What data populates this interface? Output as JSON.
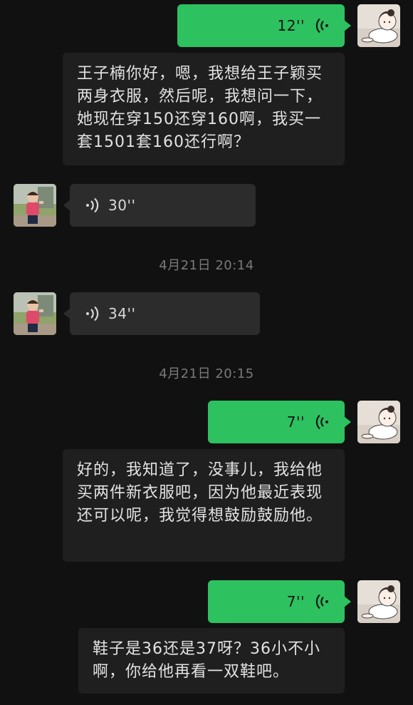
{
  "messages": [
    {
      "sender": "self",
      "type": "voice",
      "duration": "12''",
      "transcript": "王子楠你好，嗯，我想给王子颖买两身衣服，然后呢，我想问一下，她现在穿150还穿160啊，我买一套1501套160还行啊？"
    },
    {
      "sender": "other",
      "type": "voice",
      "duration": "30''"
    },
    {
      "type": "timestamp",
      "text": "4月21日 20:14"
    },
    {
      "sender": "other",
      "type": "voice",
      "duration": "34''"
    },
    {
      "type": "timestamp",
      "text": "4月21日 20:15"
    },
    {
      "sender": "self",
      "type": "voice",
      "duration": "7''",
      "transcript": "好的，我知道了，没事儿，我给他买两件新衣服吧，因为他最近表现还可以呢，我觉得想鼓励鼓励他。"
    },
    {
      "sender": "self",
      "type": "voice",
      "duration": "7''",
      "transcript": "鞋子是36还是37呀？36小不小啊，你给他再看一双鞋吧。"
    }
  ],
  "icons": {
    "voice": "voice-wave-icon",
    "self_avatar": "cartoon-baby-avatar",
    "other_avatar": "child-photo-avatar"
  },
  "colors": {
    "background": "#111111",
    "self_bubble": "#2dc160",
    "other_bubble": "#2c2c2c",
    "transcript_bubble": "#1f1f1f",
    "timestamp": "#7a7a7a"
  }
}
